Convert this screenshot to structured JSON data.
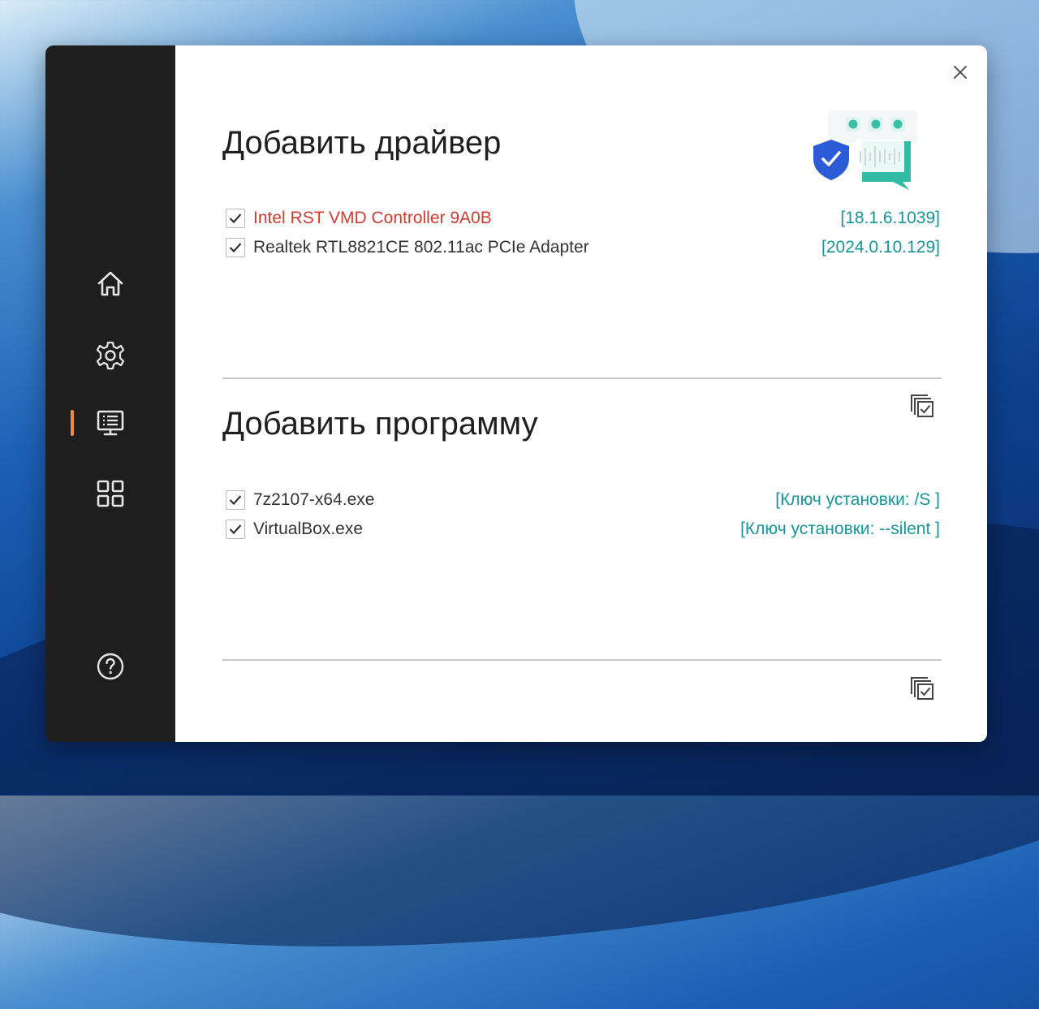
{
  "colors": {
    "accent": "#f08a3c",
    "teal": "#17959a",
    "warning": "#d03a2f",
    "sidebar": "#1e1e1e"
  },
  "sidebar": {
    "items": [
      {
        "icon": "home-icon",
        "active": false
      },
      {
        "icon": "gear-icon",
        "active": false
      },
      {
        "icon": "monitor-list-icon",
        "active": true
      },
      {
        "icon": "grid-icon",
        "active": false
      }
    ],
    "help_icon": "help-icon"
  },
  "window": {
    "close_icon": "close-icon"
  },
  "drivers": {
    "title": "Добавить драйвер",
    "items": [
      {
        "name": "Intel RST VMD Controller 9A0B",
        "version": "[18.1.6.1039]",
        "checked": true,
        "highlight": true
      },
      {
        "name": "Realtek RTL8821CE 802.11ac PCIe Adapter",
        "version": "[2024.0.10.129]",
        "checked": true,
        "highlight": false
      }
    ],
    "select_all_icon": "select-all-icon"
  },
  "programs": {
    "title": "Добавить программу",
    "items": [
      {
        "name": "7z2107-x64.exe",
        "key": "[Ключ установки: /S ]",
        "checked": true
      },
      {
        "name": "VirtualBox.exe",
        "key": "[Ключ установки: --silent ]",
        "checked": true
      }
    ],
    "select_all_icon": "select-all-icon"
  }
}
